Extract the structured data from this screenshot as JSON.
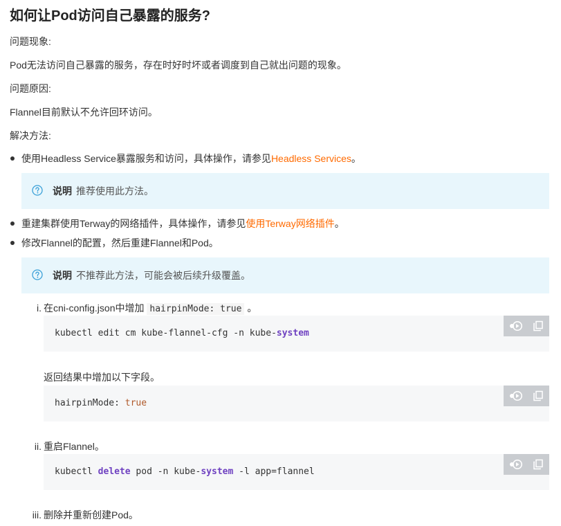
{
  "title": "如何让Pod访问自己暴露的服务?",
  "sections": {
    "symptom_label": "问题现象:",
    "symptom_text": "Pod无法访问自己暴露的服务，存在时好时坏或者调度到自己就出问题的现象。",
    "cause_label": "问题原因:",
    "cause_text": "Flannel目前默认不允许回环访问。",
    "solution_label": "解决方法:"
  },
  "solutions": [
    {
      "prefix": "使用Headless Service暴露服务和访问，具体操作，请参见",
      "link": "Headless Services",
      "suffix": "。"
    },
    {
      "prefix": "重建集群使用Terway的网络插件，具体操作，请参见",
      "link": "使用Terway网络插件",
      "suffix": "。"
    },
    {
      "prefix": "修改Flannel的配置，然后重建Flannel和Pod。",
      "link": "",
      "suffix": ""
    }
  ],
  "notes": [
    {
      "label": "说明",
      "text": "推荐使用此方法。"
    },
    {
      "label": "说明",
      "text": "不推荐此方法，可能会被后续升级覆盖。"
    }
  ],
  "steps": [
    {
      "num": "i.",
      "text_before": "在cni-config.json中增加",
      "inline_code": "hairpinMode: true",
      "text_after": "。",
      "code": {
        "pre": "kubectl edit cm kube-flannel-cfg -n kube-",
        "kw": "system",
        "post": ""
      },
      "followup": "返回结果中增加以下字段。",
      "code2": {
        "key": "hairpinMode: ",
        "val": "true"
      }
    },
    {
      "num": "ii.",
      "text": "重启Flannel。",
      "code": {
        "a": "kubectl ",
        "kw1": "delete",
        "b": " pod -n kube-",
        "kw2": "system",
        "c": " -l app=flannel"
      }
    },
    {
      "num": "iii.",
      "text": "删除并重新创建Pod。"
    }
  ],
  "colors": {
    "link": "#ff6a00",
    "note_bg": "#e8f6fc",
    "note_icon": "#3aa0d8",
    "code_bg": "#f6f7f8",
    "keyword": "#6f42c1",
    "value": "#b05a2a"
  },
  "icons": {
    "note": "question-circle-icon",
    "run": "cloud-shell-run-icon",
    "copy": "copy-icon"
  }
}
